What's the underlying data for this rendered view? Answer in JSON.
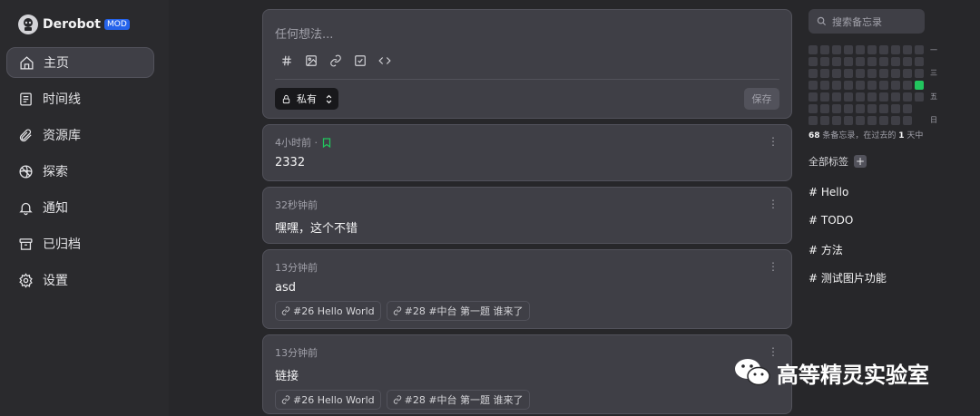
{
  "app": {
    "name": "Derobot",
    "badge": "MOD"
  },
  "sidebar": {
    "items": [
      {
        "label": "主页",
        "icon": "home-icon",
        "active": true
      },
      {
        "label": "时间线",
        "icon": "timeline-icon"
      },
      {
        "label": "资源库",
        "icon": "paperclip-icon"
      },
      {
        "label": "探索",
        "icon": "explore-icon"
      },
      {
        "label": "通知",
        "icon": "bell-icon"
      },
      {
        "label": "已归档",
        "icon": "archive-icon"
      },
      {
        "label": "设置",
        "icon": "gear-icon"
      }
    ]
  },
  "editor": {
    "placeholder": "任何想法...",
    "tools": [
      "hash-icon",
      "image-icon",
      "link-icon",
      "checkbox-icon",
      "code-icon"
    ],
    "visibility": "私有",
    "save_label": "保存"
  },
  "memos": [
    {
      "time": "4小时前 ·",
      "bookmarked": true,
      "content": "2332",
      "refs": []
    },
    {
      "time": "32秒钟前",
      "content": "嘿嘿，这个不错",
      "refs": []
    },
    {
      "time": "13分钟前",
      "content": "asd",
      "refs": [
        "#26 Hello World",
        "#28 #中台 第一题 谁来了"
      ]
    },
    {
      "time": "13分钟前",
      "content": "链接",
      "refs": [
        "#26 Hello World",
        "#28 #中台 第一题 谁来了"
      ]
    }
  ],
  "right": {
    "search_placeholder": "搜索备忘录",
    "weekday_labels": [
      "一",
      "三",
      "五",
      "日"
    ],
    "stats": {
      "count": "68",
      "text1": " 条备忘录，在过去的 ",
      "days": "1",
      "text2": " 天中"
    },
    "tags_title": "全部标签",
    "tags": [
      "# Hello",
      "# TODO",
      "# 方法",
      "# 测试图片功能"
    ]
  },
  "watermark": {
    "text": "高等精灵实验室"
  },
  "colors": {
    "accent": "#22c55e",
    "badge": "#2563eb",
    "bg": "#27272a",
    "card": "#3f3f46"
  }
}
